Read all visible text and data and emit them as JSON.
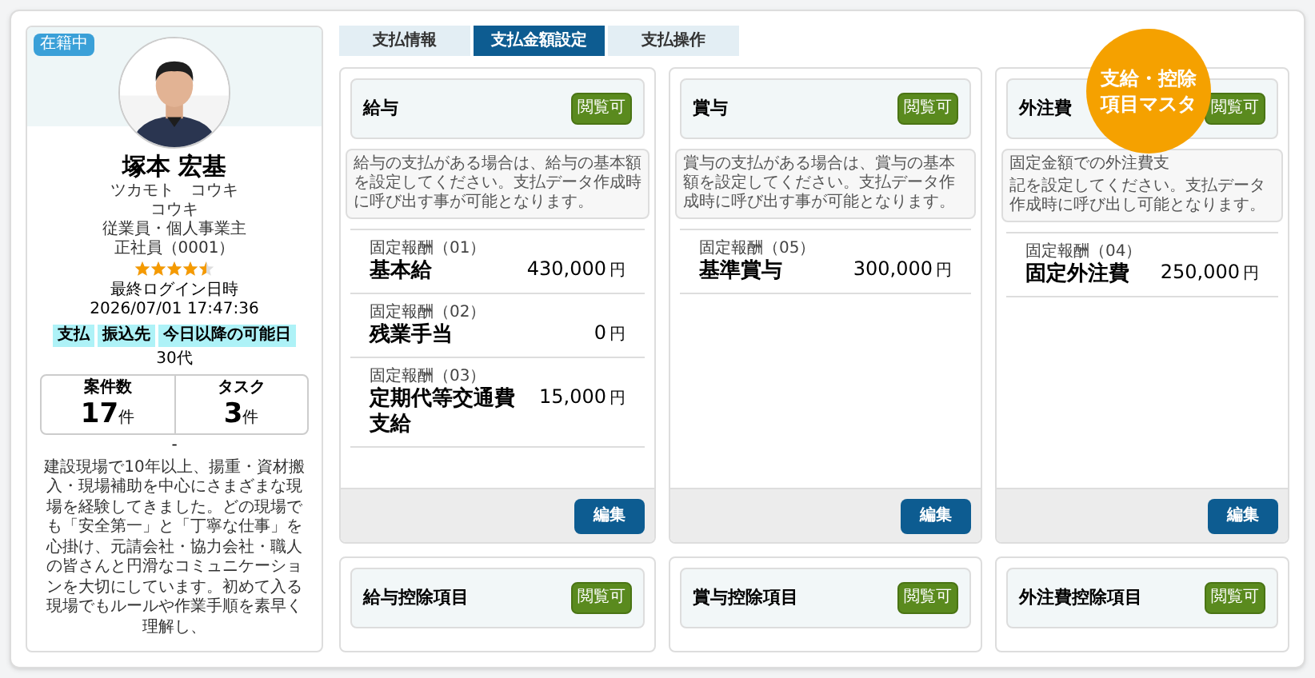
{
  "profile": {
    "status": "在籍中",
    "name": "塚本 宏基",
    "kana": "ツカモト　コウキ",
    "nickname": "コウキ",
    "role": "従業員・個人事業主",
    "employment": "正社員（0001）",
    "stars": 4.5,
    "login_label": "最終ログイン日時",
    "login_time": "2026/07/01 17:47:36",
    "tags": [
      "支払",
      "振込先",
      "今日以降の可能日"
    ],
    "age": "30代",
    "stats": [
      {
        "label": "案件数",
        "value": "17",
        "unit": "件"
      },
      {
        "label": "タスク",
        "value": "3",
        "unit": "件"
      }
    ],
    "separator": "-",
    "bio": "建設現場で10年以上、揚重・資材搬入・現場補助を中心にさまざまな現場を経験してきました。どの現場でも「安全第一」と「丁寧な仕事」を心掛け、元請会社・協力会社・職人の皆さんと円滑なコミュニケーションを大切にしています。初めて入る現場でもルールや作業手順を素早く理解し、"
  },
  "tabs": [
    {
      "label": "支払情報",
      "selected": false
    },
    {
      "label": "支払金額設定",
      "selected": true
    },
    {
      "label": "支払操作",
      "selected": false
    }
  ],
  "cards": [
    {
      "title": "給与",
      "badge": "閲覧可",
      "description": [
        "給与の支払がある場合は、給与の基本額を設定してください。支払データ作成時に呼び出す事が可能となります。"
      ],
      "items": [
        {
          "label": "固定報酬（01）",
          "name": "基本給",
          "amount": "430,000",
          "unit": "円"
        },
        {
          "label": "固定報酬（02）",
          "name": "残業手当",
          "amount": "0",
          "unit": "円"
        },
        {
          "label": "固定報酬（03）",
          "name": "定期代等交通費支給",
          "amount": "15,000",
          "unit": "円"
        }
      ],
      "button": "編集"
    },
    {
      "title": "賞与",
      "badge": "閲覧可",
      "description": [
        "賞与の支払がある場合は、賞与の基本額を設定してください。支払データ作成時に呼び出す事が可能となります。"
      ],
      "items": [
        {
          "label": "固定報酬（05）",
          "name": "基準賞与",
          "amount": "300,000",
          "unit": "円"
        }
      ],
      "button": "編集"
    },
    {
      "title": "外注費",
      "badge": "閲覧可",
      "description": [
        "固定金額での外注費支",
        "記を設定してください。支払データ作成時に呼び出し可能となります。"
      ],
      "items": [
        {
          "label": "固定報酬（04）",
          "name": "固定外注費",
          "amount": "250,000",
          "unit": "円"
        }
      ],
      "button": "編集"
    }
  ],
  "deduction_cards": [
    {
      "title": "給与控除項目",
      "badge": "閲覧可"
    },
    {
      "title": "賞与控除項目",
      "badge": "閲覧可"
    },
    {
      "title": "外注費控除項目",
      "badge": "閲覧可"
    }
  ],
  "overlay_badge": [
    "支給・控除",
    "項目マスタ"
  ]
}
